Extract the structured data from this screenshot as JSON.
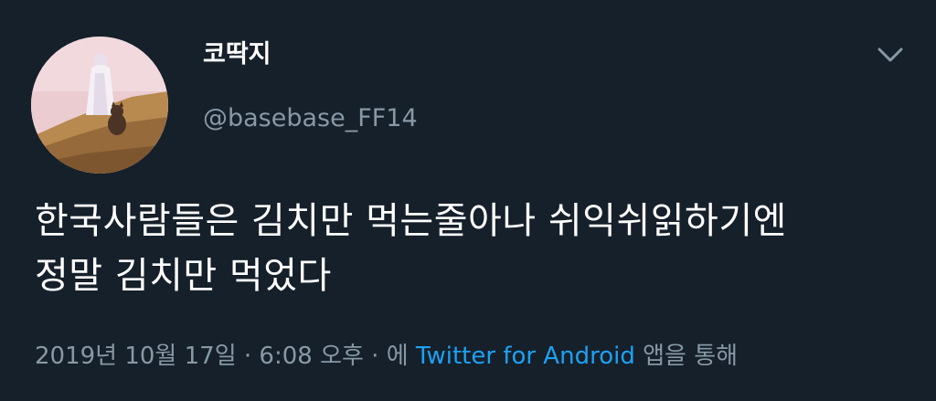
{
  "tweet": {
    "display_name": "코딱지",
    "handle": "@basebase_FF14",
    "menu_icon": "chevron-down-icon",
    "text_lines": [
      "한국사람들은 김치만 먹는줄아나 쉬익쉬읽하기엔",
      "정말 김치만 먹었다"
    ],
    "meta": {
      "timestamp": "2019년 10월 17일 · 6:08 오후 · 에",
      "source": "Twitter for Android",
      "suffix": "앱을 통해"
    }
  },
  "colors": {
    "background": "#15202b",
    "primary_text": "#ffffff",
    "secondary_text": "#8899a6",
    "link": "#1da1f2"
  }
}
